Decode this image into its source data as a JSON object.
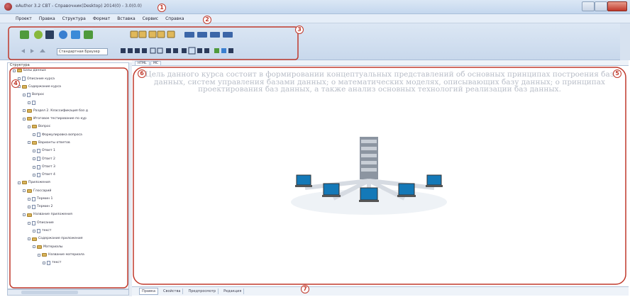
{
  "window": {
    "title": "eAuthor 3.2 CBT - Справочник(Desktop) 2014(0) - 3.0(0.0)"
  },
  "menu": [
    "Проект",
    "Правка",
    "Структура",
    "Формат",
    "Вставка",
    "Сервис",
    "Справка"
  ],
  "toolbar": {
    "format_select_value": "Стандартная Браузер",
    "colors": {
      "green": "#3f8a2f",
      "blue": "#2f6fb5",
      "orange": "#d4862a",
      "red": "#c23b2b"
    }
  },
  "left_panel": {
    "title": "Структура",
    "tree": [
      {
        "label": "Базы данных",
        "level": 0,
        "icon": "folder"
      },
      {
        "label": "Описание курса",
        "level": 1,
        "icon": "doc"
      },
      {
        "label": "Содержание курса",
        "level": 1,
        "icon": "folder"
      },
      {
        "label": "Вопрос",
        "level": 2,
        "icon": "doc"
      },
      {
        "label": "",
        "level": 3,
        "icon": "doc"
      },
      {
        "label": "Раздел 2. Классификация баз д",
        "level": 2,
        "icon": "folder"
      },
      {
        "label": "Итоговое тестирование по кур",
        "level": 2,
        "icon": "folder"
      },
      {
        "label": "Вопрос",
        "level": 3,
        "icon": "folder"
      },
      {
        "label": "Формулировка вопроса",
        "level": 4,
        "icon": "doc"
      },
      {
        "label": "Варианты ответов",
        "level": 3,
        "icon": "folder"
      },
      {
        "label": "Ответ 1",
        "level": 4,
        "icon": "doc"
      },
      {
        "label": "Ответ 2",
        "level": 4,
        "icon": "doc"
      },
      {
        "label": "Ответ 3",
        "level": 4,
        "icon": "doc"
      },
      {
        "label": "Ответ 4",
        "level": 4,
        "icon": "doc"
      },
      {
        "label": "Приложения",
        "level": 1,
        "icon": "folder"
      },
      {
        "label": "Глоссарий",
        "level": 2,
        "icon": "folder"
      },
      {
        "label": "Термин 1",
        "level": 3,
        "icon": "doc"
      },
      {
        "label": "Термин 2",
        "level": 3,
        "icon": "doc"
      },
      {
        "label": "Название приложения",
        "level": 2,
        "icon": "folder"
      },
      {
        "label": "Описание",
        "level": 3,
        "icon": "doc"
      },
      {
        "label": "текст",
        "level": 4,
        "icon": "doc"
      },
      {
        "label": "Содержание приложения",
        "level": 3,
        "icon": "folder"
      },
      {
        "label": "Материалы",
        "level": 4,
        "icon": "folder"
      },
      {
        "label": "Название материала",
        "level": 5,
        "icon": "folder"
      },
      {
        "label": "текст",
        "level": 6,
        "icon": "doc"
      }
    ]
  },
  "document_tabs": [
    "HTML",
    "МС"
  ],
  "content": {
    "text": "Цель данного курса состоит в формировании концептуальных представлений об основных принципах построения баз данных, систем управления базами данных; о математических моделях, описывающих базу данных; о принципах проектирования баз данных, а также анализ основных технологий реализации баз данных."
  },
  "bottom_tabs": [
    "Правка",
    "Свойства",
    "Предпросмотр",
    "Редакция"
  ],
  "callouts": [
    "1",
    "2",
    "3",
    "4",
    "5",
    "6",
    "7"
  ]
}
